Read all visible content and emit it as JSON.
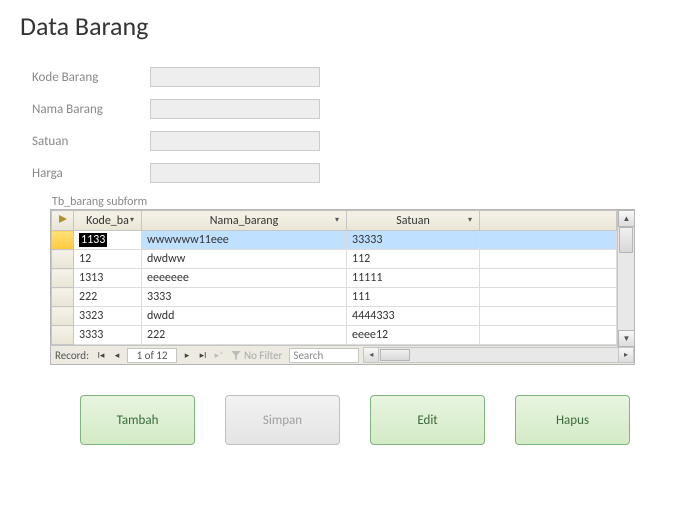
{
  "title": "Data Barang",
  "form": {
    "fields": [
      {
        "label": "Kode Barang",
        "value": ""
      },
      {
        "label": "Nama Barang",
        "value": ""
      },
      {
        "label": "Satuan",
        "value": ""
      },
      {
        "label": "Harga",
        "value": ""
      }
    ]
  },
  "subform": {
    "label": "Tb_barang subform",
    "columns": [
      "Kode_ba",
      "Nama_barang",
      "Satuan"
    ],
    "rows": [
      {
        "kode": "1133",
        "nama": "wwwwww11eee",
        "satuan": "33333",
        "selected": true,
        "editing": true
      },
      {
        "kode": "12",
        "nama": "dwdww",
        "satuan": "112"
      },
      {
        "kode": "1313",
        "nama": "eeeeeee",
        "satuan": "11111"
      },
      {
        "kode": "222",
        "nama": "3333",
        "satuan": "111"
      },
      {
        "kode": "3323",
        "nama": "dwdd",
        "satuan": "4444333"
      },
      {
        "kode": "3333",
        "nama": "222",
        "satuan": "eeee12"
      }
    ],
    "nav": {
      "label": "Record:",
      "counter": "1 of 12",
      "filter_label": "No Filter",
      "search_placeholder": "Search"
    }
  },
  "buttons": {
    "tambah": "Tambah",
    "simpan": "Simpan",
    "edit": "Edit",
    "hapus": "Hapus"
  }
}
